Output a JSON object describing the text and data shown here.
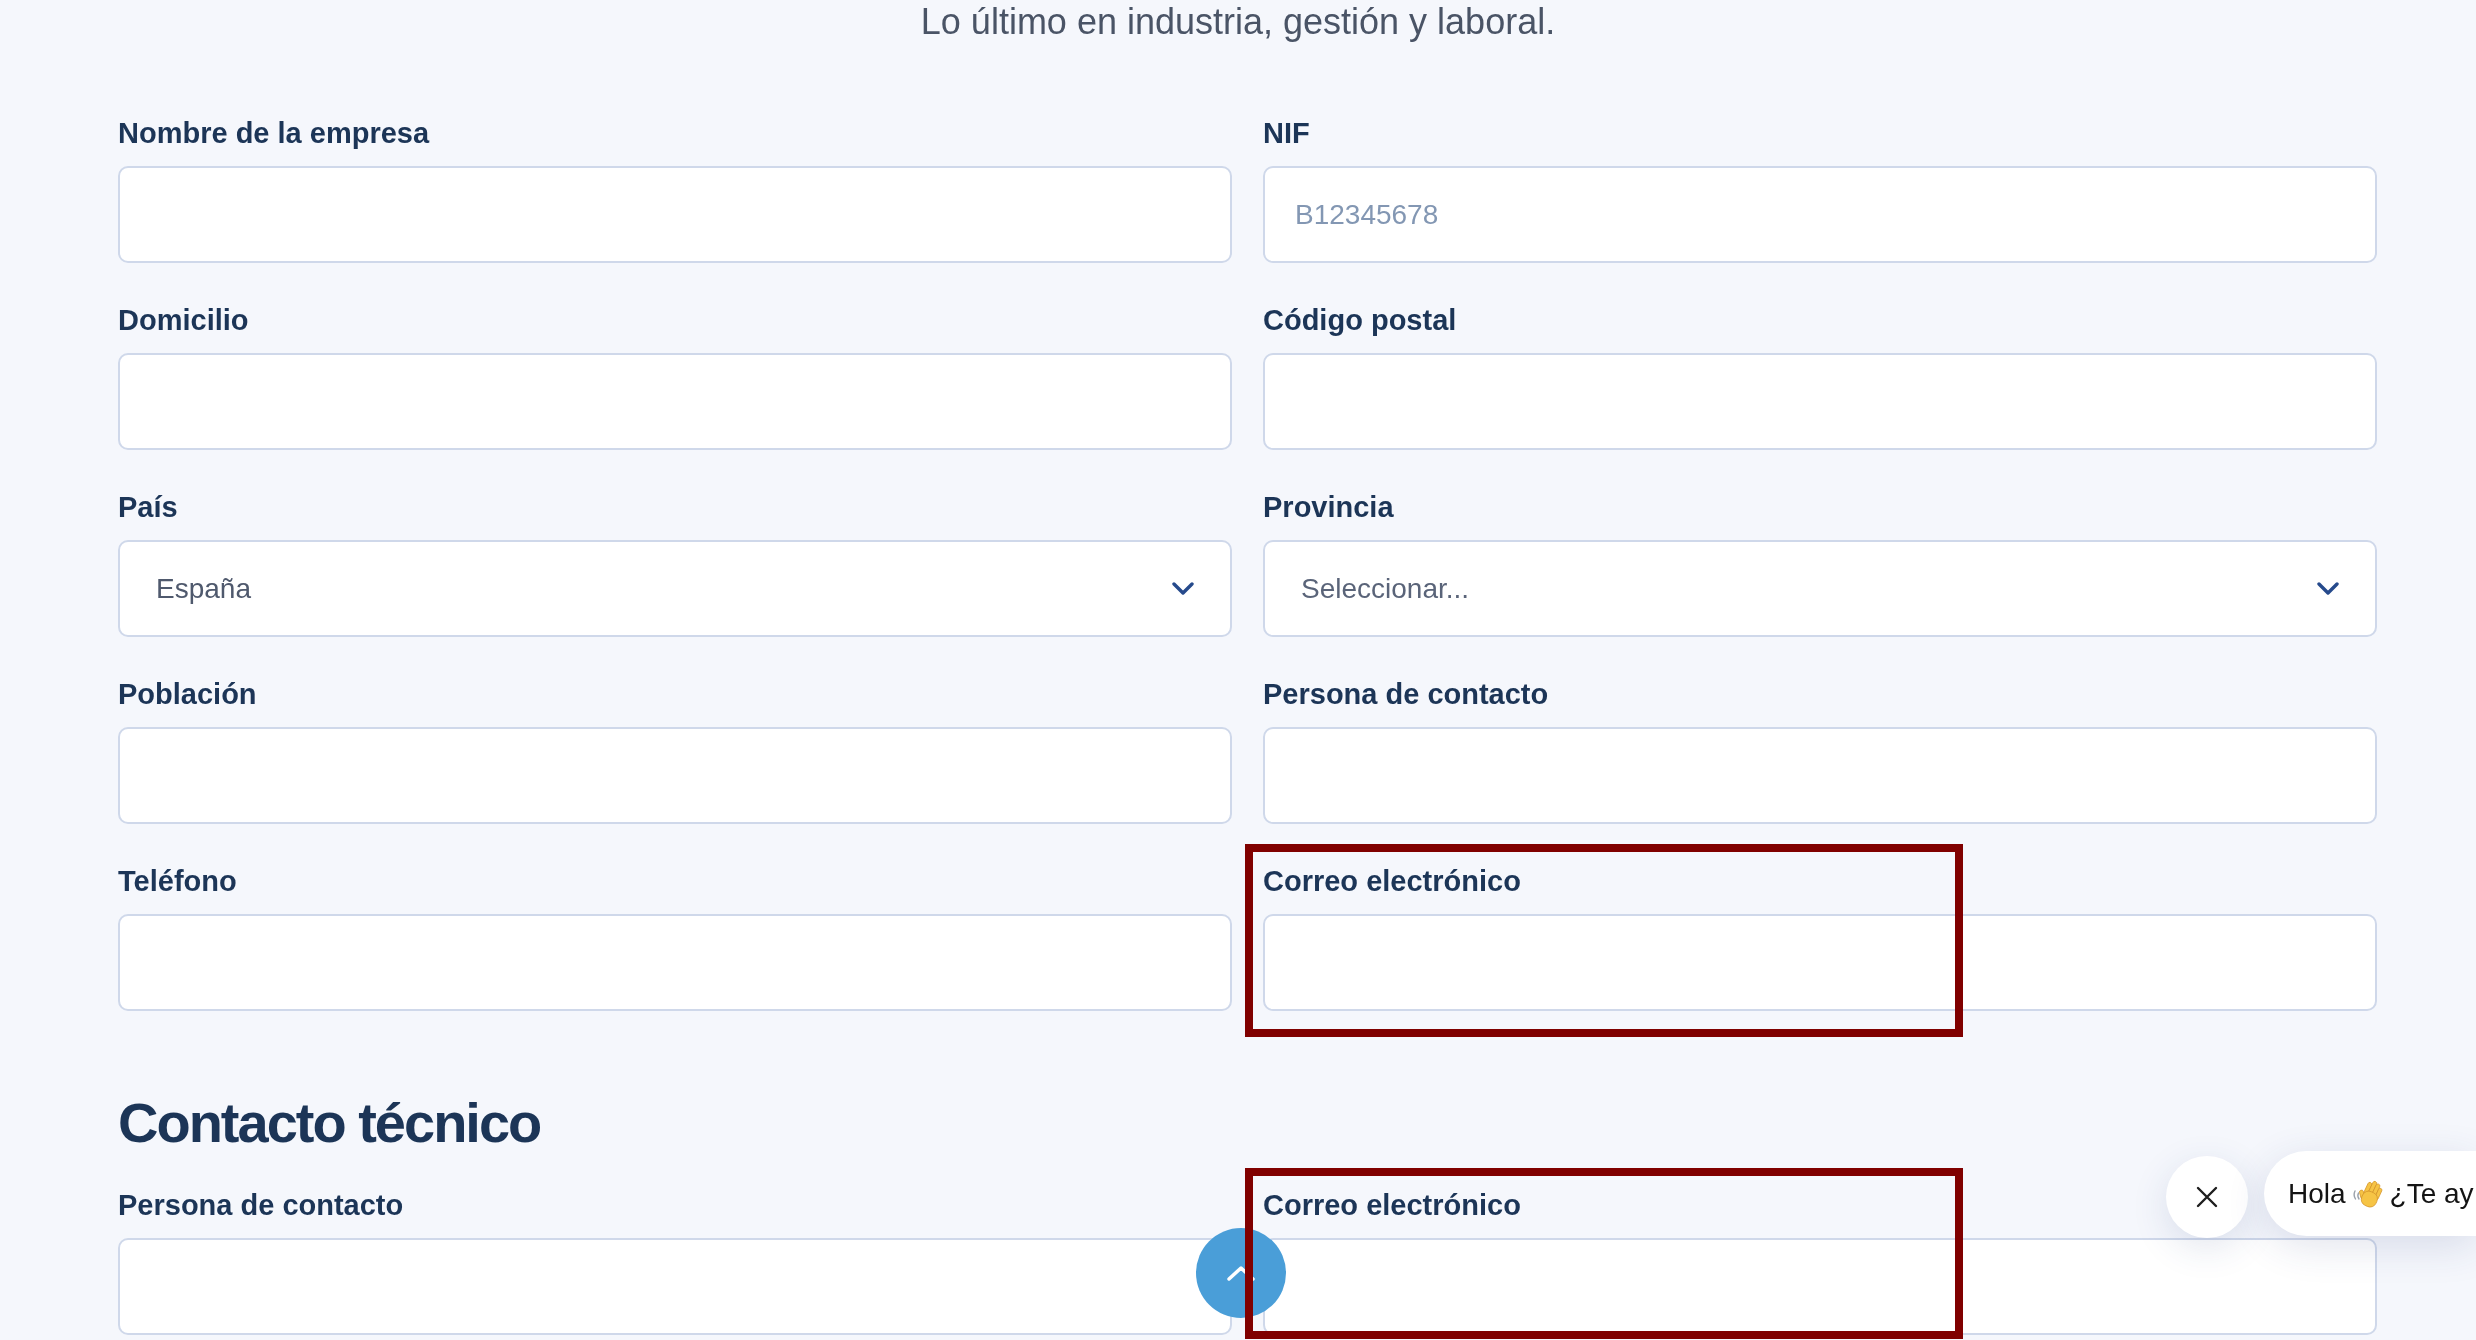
{
  "subtitle": "Lo último en industria, gestión y laboral.",
  "sections": [
    {
      "fields": [
        {
          "label": "Nombre de la empresa",
          "kind": "text",
          "highlighted": false
        },
        {
          "label": "NIF",
          "kind": "text",
          "placeholder": "B12345678",
          "highlighted": false
        },
        {
          "label": "Domicilio",
          "kind": "text",
          "highlighted": false
        },
        {
          "label": "Código postal",
          "kind": "text",
          "highlighted": false
        },
        {
          "label": "País",
          "kind": "select",
          "value": "España",
          "highlighted": false
        },
        {
          "label": "Provincia",
          "kind": "select",
          "placeholder": "Seleccionar...",
          "highlighted": false
        },
        {
          "label": "Población",
          "kind": "text",
          "highlighted": false
        },
        {
          "label": "Persona de contacto",
          "kind": "text",
          "highlighted": false
        },
        {
          "label": "Teléfono",
          "kind": "text",
          "highlighted": false
        },
        {
          "label": "Correo electrónico",
          "kind": "text",
          "highlighted": true
        }
      ]
    },
    {
      "heading": "Contacto técnico",
      "fields": [
        {
          "label": "Persona de contacto",
          "kind": "text",
          "highlighted": false
        },
        {
          "label": "Correo electrónico",
          "kind": "text",
          "highlighted": true
        }
      ]
    }
  ],
  "chat_prompt": {
    "greeting": "Hola",
    "message": "¿Te ay"
  }
}
